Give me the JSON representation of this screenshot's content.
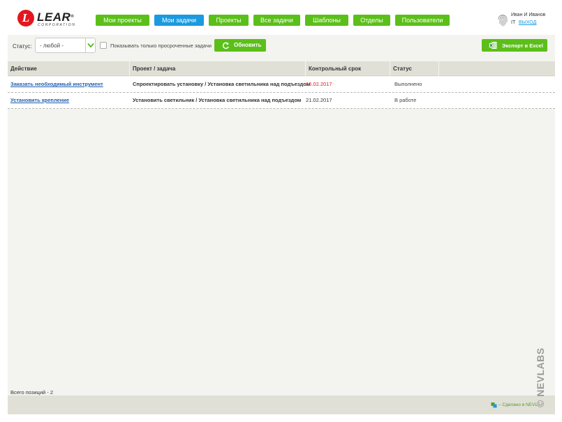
{
  "header": {
    "logo_text": "LEAR",
    "logo_reg": "®",
    "logo_sub": "CORPORATION",
    "nav": [
      {
        "label": "Мои проекты",
        "active": false
      },
      {
        "label": "Мои задачи",
        "active": true
      },
      {
        "label": "Проекты",
        "active": false
      },
      {
        "label": "Все задачи",
        "active": false
      },
      {
        "label": "Шаблоны",
        "active": false
      },
      {
        "label": "Отделы",
        "active": false
      },
      {
        "label": "Пользователи",
        "active": false
      }
    ],
    "user": {
      "name": "Иван И Иванов",
      "department": "IT",
      "logout_label": "ВЫХОД"
    }
  },
  "toolbar": {
    "status_label": "Статус:",
    "status_value": "- любой -",
    "overdue_only_label": "Показывать только просроченные задачи",
    "overdue_only_checked": false,
    "refresh_label": "Обновить",
    "export_label": "Экспорт в Excel"
  },
  "table": {
    "columns": [
      "Действие",
      "Проект / задача",
      "Контрольный срок",
      "Статус",
      ""
    ],
    "rows": [
      {
        "action": "Заказать необходимый инструмент",
        "project_task": "Спроектировать установку / Установка светильника над подъездом",
        "deadline": "16.02.2017",
        "overdue": true,
        "status": "Выполнено"
      },
      {
        "action": "Установить крепление",
        "project_task": "Установить светильник / Установка светильника над подъездом",
        "deadline": "21.02.2017",
        "overdue": false,
        "status": "В работе"
      }
    ]
  },
  "footer": {
    "total_label": "Всего позиций - 2",
    "made_by": "– Сделано в NEVL",
    "watermark": "© NEVLABS"
  },
  "colors": {
    "accent_green": "#5bbf19",
    "active_blue": "#1a9ae0",
    "overdue_red": "#e4161f",
    "link_blue": "#1f5fb0"
  }
}
